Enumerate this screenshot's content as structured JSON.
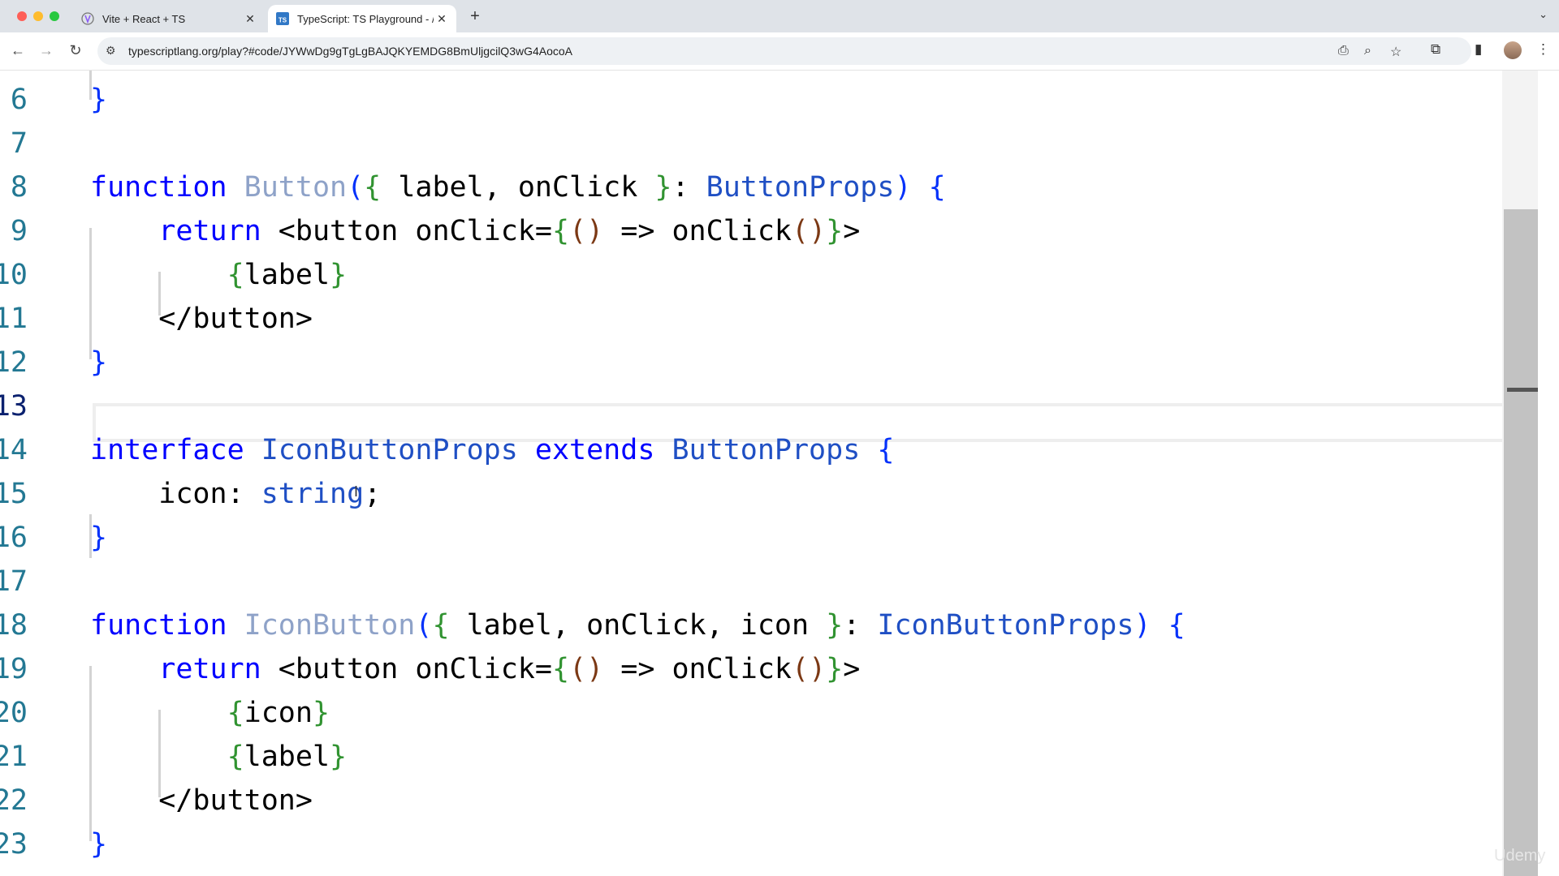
{
  "browser": {
    "tabs": [
      {
        "title": "Vite + React + TS",
        "active": false,
        "favicon": "vite-icon"
      },
      {
        "title": "TypeScript: TS Playground - /",
        "active": true,
        "favicon": "typescript-icon"
      }
    ],
    "url": "typescriptlang.org/play?#code/JYWwDg9gTgLgBAJQKYEMDG8BmUljgcilQ3wG4AocoA"
  },
  "editor": {
    "lines": [
      {
        "n": "6",
        "code": "}"
      },
      {
        "n": "7",
        "code": ""
      },
      {
        "n": "8",
        "code": "function Button({ label, onClick }: ButtonProps) {"
      },
      {
        "n": "9",
        "code": "    return <button onClick={() => onClick()}>"
      },
      {
        "n": "10",
        "code": "        {label}"
      },
      {
        "n": "11",
        "code": "    </button>"
      },
      {
        "n": "12",
        "code": "}"
      },
      {
        "n": "13",
        "code": ""
      },
      {
        "n": "14",
        "code": "interface IconButtonProps extends ButtonProps {"
      },
      {
        "n": "15",
        "code": "    icon: string;"
      },
      {
        "n": "16",
        "code": "}"
      },
      {
        "n": "17",
        "code": ""
      },
      {
        "n": "18",
        "code": "function IconButton({ label, onClick, icon }: IconButtonProps) {"
      },
      {
        "n": "19",
        "code": "    return <button onClick={() => onClick()}>"
      },
      {
        "n": "20",
        "code": "        {icon}"
      },
      {
        "n": "21",
        "code": "        {label}"
      },
      {
        "n": "22",
        "code": "    </button>"
      },
      {
        "n": "23",
        "code": "}"
      }
    ],
    "current_line": "13"
  },
  "watermark": "Udemy"
}
